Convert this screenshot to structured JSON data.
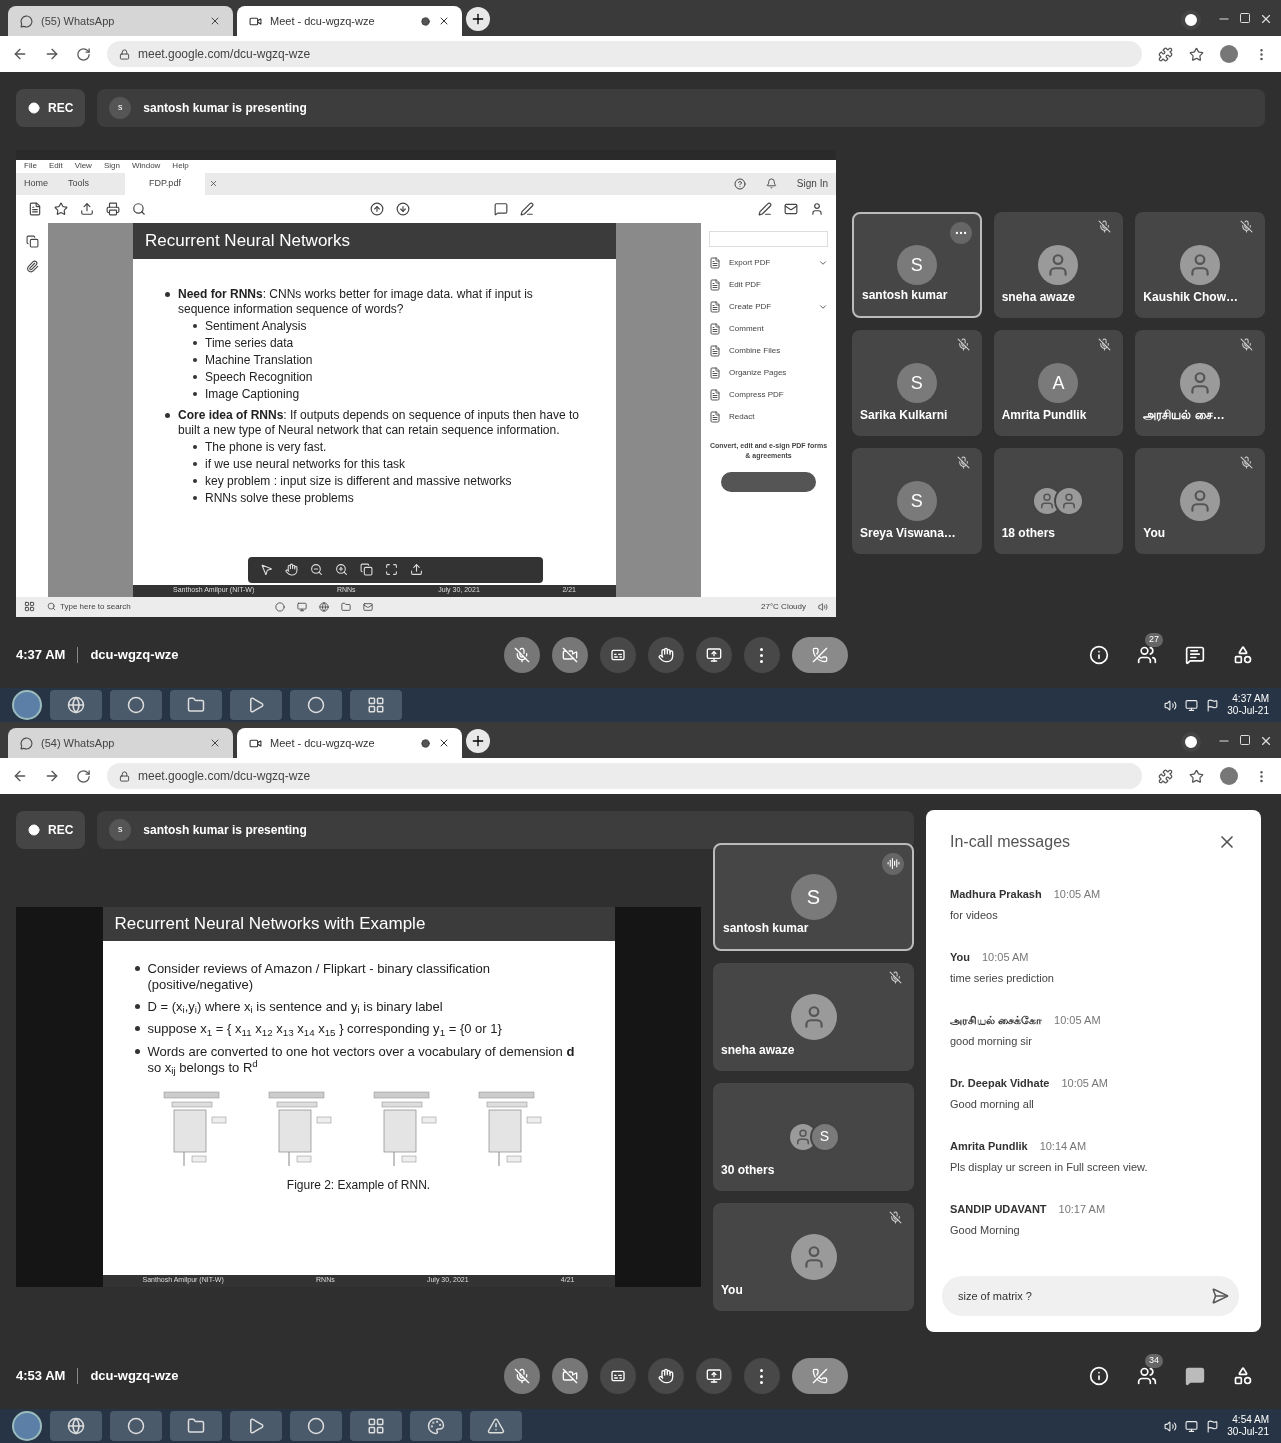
{
  "screens": [
    {
      "tabs": [
        {
          "label": "(55) WhatsApp",
          "kind": "whatsapp",
          "selected": false
        },
        {
          "label": "Meet - dcu-wgzq-wze",
          "kind": "meet",
          "selected": true
        }
      ],
      "address": "meet.google.com/dcu-wgzq-wze",
      "rec": "REC",
      "presenter_initial": "s",
      "presenting": "santosh kumar is presenting",
      "share": {
        "kind": "acrobat",
        "menu": [
          "File",
          "Edit",
          "View",
          "Sign",
          "Window",
          "Help"
        ],
        "nav_tabs": [
          "Home",
          "Tools"
        ],
        "doc_tab": "FDP.pdf",
        "sign_in": "Sign In",
        "tools": [
          {
            "label": "Export PDF",
            "has_menu": true
          },
          {
            "label": "Edit PDF",
            "has_menu": false
          },
          {
            "label": "Create PDF",
            "has_menu": true
          },
          {
            "label": "Comment",
            "has_menu": false
          },
          {
            "label": "Combine Files",
            "has_menu": false
          },
          {
            "label": "Organize Pages",
            "has_menu": false
          },
          {
            "label": "Compress PDF",
            "has_menu": false
          },
          {
            "label": "Redact",
            "has_menu": false
          }
        ],
        "promo": "Convert, edit and e-sign PDF forms & agreements",
        "search_placeholder": "Type here to search",
        "weather": "27°C Cloudy",
        "slide": {
          "title": "Recurrent Neural Networks",
          "bullets": [
            {
              "text": "**Need for RNNs**: CNNs works better for image data. what if input is sequence information sequence of words?",
              "children": [
                {
                  "text": "Sentiment Analysis"
                },
                {
                  "text": "Time series data"
                },
                {
                  "text": "Machine Translation"
                },
                {
                  "text": "Speech Recognition"
                },
                {
                  "text": "Image Captioning"
                }
              ]
            },
            {
              "text": "**Core idea of RNNs**: If outputs depends on sequence of inputs then have to built a new type of Neural network that can retain sequence information.",
              "children": [
                {
                  "text": "The phone is very fast."
                },
                {
                  "text": "if we use neural networks for this task"
                },
                {
                  "text": "key problem : input size is different and massive networks"
                },
                {
                  "text": "RNNs solve these problems"
                }
              ]
            }
          ],
          "footer": [
            "Santhosh Amilpur (NIT-W)",
            "RNNs",
            "July 30, 2021",
            "2/21"
          ]
        }
      },
      "tiles": [
        {
          "name": "santosh kumar",
          "avatar": {
            "kind": "letter",
            "letter": "S"
          },
          "hovered": true,
          "muted": false,
          "speaking": false,
          "active": true
        },
        {
          "name": "sneha awaze",
          "avatar": {
            "kind": "photo"
          },
          "hovered": false,
          "muted": true,
          "speaking": false,
          "active": false
        },
        {
          "name": "Kaushik Chow…",
          "avatar": {
            "kind": "photo"
          },
          "hovered": false,
          "muted": true,
          "speaking": false,
          "active": false
        },
        {
          "name": "Sarika Kulkarni",
          "avatar": {
            "kind": "letter",
            "letter": "S"
          },
          "hovered": false,
          "muted": true,
          "speaking": false,
          "active": false
        },
        {
          "name": "Amrita Pundlik",
          "avatar": {
            "kind": "letter",
            "letter": "A"
          },
          "hovered": false,
          "muted": true,
          "speaking": false,
          "active": false
        },
        {
          "name": "அரசியல் சை…",
          "avatar": {
            "kind": "photo"
          },
          "hovered": false,
          "muted": true,
          "speaking": false,
          "active": false
        },
        {
          "name": "Sreya Viswana…",
          "avatar": {
            "kind": "letter",
            "letter": "S"
          },
          "hovered": false,
          "muted": true,
          "speaking": false,
          "active": false
        },
        {
          "name": "18 others",
          "avatar": {
            "kind": "group"
          },
          "hovered": false,
          "muted": false,
          "speaking": false,
          "active": false
        },
        {
          "name": "You",
          "avatar": {
            "kind": "photo"
          },
          "hovered": false,
          "muted": true,
          "speaking": false,
          "active": false
        }
      ],
      "time": "4:37 AM",
      "meeting_code": "dcu-wgzq-wze",
      "people_count": "27",
      "chat_open": false,
      "taskbar_apps": [
        {
          "kind": "ie"
        },
        {
          "kind": "chrome"
        },
        {
          "kind": "files"
        },
        {
          "kind": "media"
        },
        {
          "kind": "chrome"
        },
        {
          "kind": "app"
        }
      ],
      "clock": "4:37 AM",
      "date": "30-Jul-21"
    },
    {
      "tabs": [
        {
          "label": "(54) WhatsApp",
          "kind": "whatsapp",
          "selected": false
        },
        {
          "label": "Meet - dcu-wgzq-wze",
          "kind": "meet",
          "selected": true
        }
      ],
      "address": "meet.google.com/dcu-wgzq-wze",
      "rec": "REC",
      "presenter_initial": "s",
      "presenting": "santosh kumar is presenting",
      "share": {
        "kind": "slide",
        "slide": {
          "title": "Recurrent Neural Networks with Example",
          "bullets": [
            {
              "text": "Consider reviews of Amazon / Flipkart - binary classification (positive/negative)"
            },
            {
              "text": "D = (x$_{i}$,y$_{i}$) where x$_{i}$ is sentence and y$_{i}$ is binary label"
            },
            {
              "text": "suppose x$_{1}$ = { x$_{11}$ x$_{12}$ x$_{13}$ x$_{14}$ x$_{15}$ } corresponding y$_{1}$ = {0 or 1}"
            },
            {
              "text": "Words are converted to one hot vectors over a vocabulary of demension **d** so x$_{ij}$ belongs to R$^{d}$"
            }
          ],
          "figure_caption": "Figure 2: Example of RNN.",
          "footer": [
            "Santhosh Amilpur (NIT-W)",
            "RNNs",
            "July 30, 2021",
            "4/21"
          ]
        }
      },
      "tiles": [
        {
          "name": "santosh kumar",
          "avatar": {
            "kind": "letter",
            "letter": "S"
          },
          "hovered": false,
          "muted": false,
          "speaking": true,
          "active": true
        },
        {
          "name": "sneha awaze",
          "avatar": {
            "kind": "photo"
          },
          "hovered": false,
          "muted": true,
          "speaking": false,
          "active": false
        },
        {
          "name": "30 others",
          "avatar": {
            "kind": "group",
            "letter": "S"
          },
          "hovered": false,
          "muted": false,
          "speaking": false,
          "active": false
        },
        {
          "name": "You",
          "avatar": {
            "kind": "photo"
          },
          "hovered": false,
          "muted": true,
          "speaking": false,
          "active": false
        }
      ],
      "chat": {
        "title": "In-call messages",
        "input": "size of matrix ?",
        "messages": [
          {
            "sender": "Madhura Prakash",
            "time": "10:05 AM",
            "text": "for videos"
          },
          {
            "sender": "You",
            "time": "10:05 AM",
            "text": "time series prediction"
          },
          {
            "sender": "அரசியல் சைக்கோ",
            "time": "10:05 AM",
            "text": "good morning sir"
          },
          {
            "sender": "Dr. Deepak Vidhate",
            "time": "10:05 AM",
            "text": "Good morning all"
          },
          {
            "sender": "Amrita Pundlik",
            "time": "10:14 AM",
            "text": "Pls display ur screen in Full screen view."
          },
          {
            "sender": "SANDIP UDAVANT",
            "time": "10:17 AM",
            "text": "Good Morning"
          }
        ]
      },
      "time": "4:53 AM",
      "meeting_code": "dcu-wgzq-wze",
      "people_count": "34",
      "chat_open": true,
      "taskbar_apps": [
        {
          "kind": "ie"
        },
        {
          "kind": "chrome"
        },
        {
          "kind": "files"
        },
        {
          "kind": "media"
        },
        {
          "kind": "chrome"
        },
        {
          "kind": "app"
        },
        {
          "kind": "paint"
        },
        {
          "kind": "warning"
        }
      ],
      "clock": "4:54 AM",
      "date": "30-Jul-21"
    }
  ]
}
